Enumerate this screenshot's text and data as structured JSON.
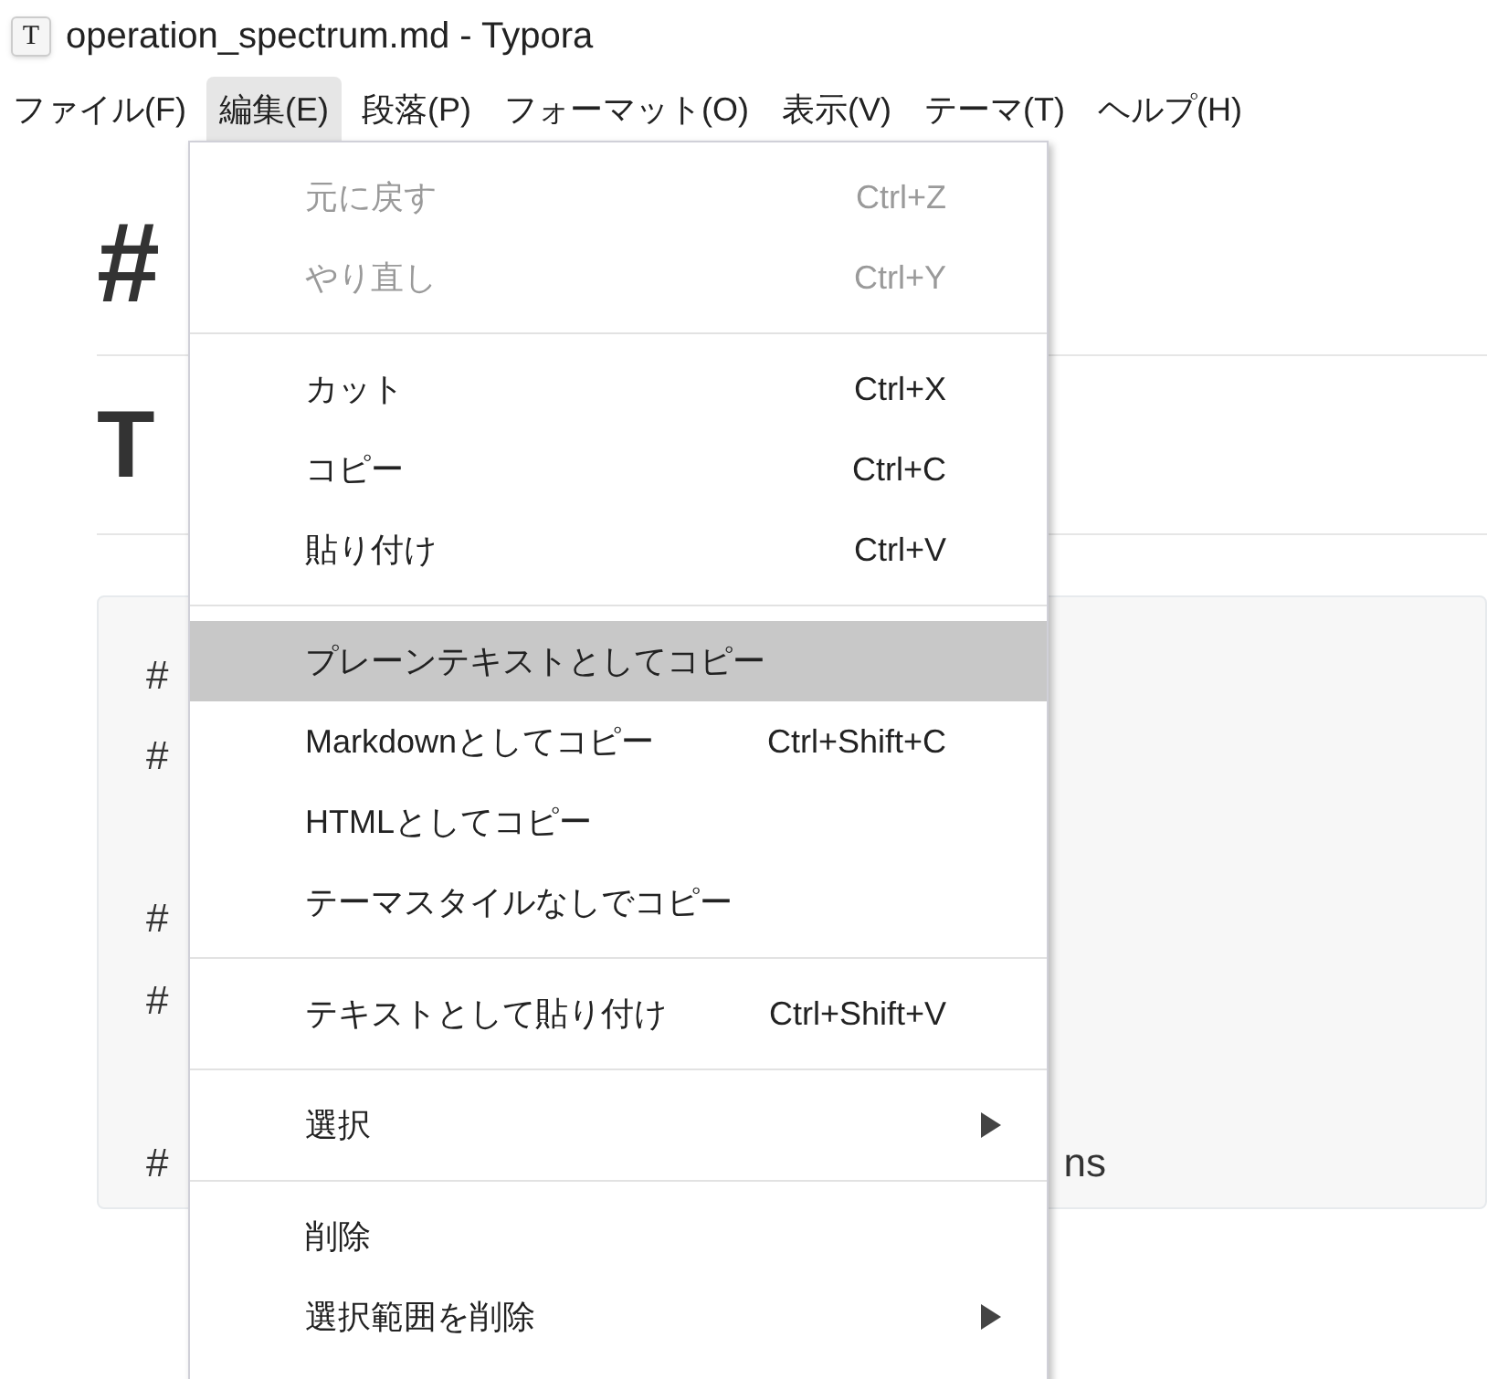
{
  "window": {
    "title": "operation_spectrum.md - Typora",
    "icon_letter": "T"
  },
  "menubar": [
    {
      "label": "ファイル(F)",
      "selected": false
    },
    {
      "label": "編集(E)",
      "selected": true
    },
    {
      "label": "段落(P)",
      "selected": false
    },
    {
      "label": "フォーマット(O)",
      "selected": false
    },
    {
      "label": "表示(V)",
      "selected": false
    },
    {
      "label": "テーマ(T)",
      "selected": false
    },
    {
      "label": "ヘルプ(H)",
      "selected": false
    }
  ],
  "document": {
    "heading_1": "#",
    "heading_2": "T",
    "code_lines": [
      {
        "kind": "line",
        "text": "#"
      },
      {
        "kind": "line",
        "text": "#"
      },
      {
        "kind": "blank"
      },
      {
        "kind": "line",
        "text": "#"
      },
      {
        "kind": "line",
        "text": "#"
      },
      {
        "kind": "blank"
      },
      {
        "kind": "line",
        "text": "#"
      }
    ],
    "code_line_tail": "ns"
  },
  "menu": [
    {
      "kind": "item",
      "label": "元に戻す",
      "shortcut": "Ctrl+Z",
      "disabled": true,
      "selected": false,
      "submenu": false
    },
    {
      "kind": "item",
      "label": "やり直し",
      "shortcut": "Ctrl+Y",
      "disabled": true,
      "selected": false,
      "submenu": false
    },
    {
      "kind": "separator"
    },
    {
      "kind": "item",
      "label": "カット",
      "shortcut": "Ctrl+X",
      "disabled": false,
      "selected": false,
      "submenu": false
    },
    {
      "kind": "item",
      "label": "コピー",
      "shortcut": "Ctrl+C",
      "disabled": false,
      "selected": false,
      "submenu": false
    },
    {
      "kind": "item",
      "label": "貼り付け",
      "shortcut": "Ctrl+V",
      "disabled": false,
      "selected": false,
      "submenu": false
    },
    {
      "kind": "separator"
    },
    {
      "kind": "item",
      "label": "プレーンテキストとしてコピー",
      "disabled": false,
      "selected": true,
      "submenu": false
    },
    {
      "kind": "item",
      "label": "Markdownとしてコピー",
      "shortcut": "Ctrl+Shift+C",
      "disabled": false,
      "selected": false,
      "submenu": false
    },
    {
      "kind": "item",
      "label": "HTMLとしてコピー",
      "disabled": false,
      "selected": false,
      "submenu": false
    },
    {
      "kind": "item",
      "label": "テーマスタイルなしでコピー",
      "disabled": false,
      "selected": false,
      "submenu": false
    },
    {
      "kind": "separator"
    },
    {
      "kind": "item",
      "label": "テキストとして貼り付け",
      "shortcut": "Ctrl+Shift+V",
      "disabled": false,
      "selected": false,
      "submenu": false
    },
    {
      "kind": "separator"
    },
    {
      "kind": "item",
      "label": "選択",
      "disabled": false,
      "selected": false,
      "submenu": true
    },
    {
      "kind": "separator"
    },
    {
      "kind": "item",
      "label": "削除",
      "disabled": false,
      "selected": false,
      "submenu": false
    },
    {
      "kind": "item",
      "label": "選択範囲を削除",
      "disabled": false,
      "selected": false,
      "submenu": true
    }
  ]
}
